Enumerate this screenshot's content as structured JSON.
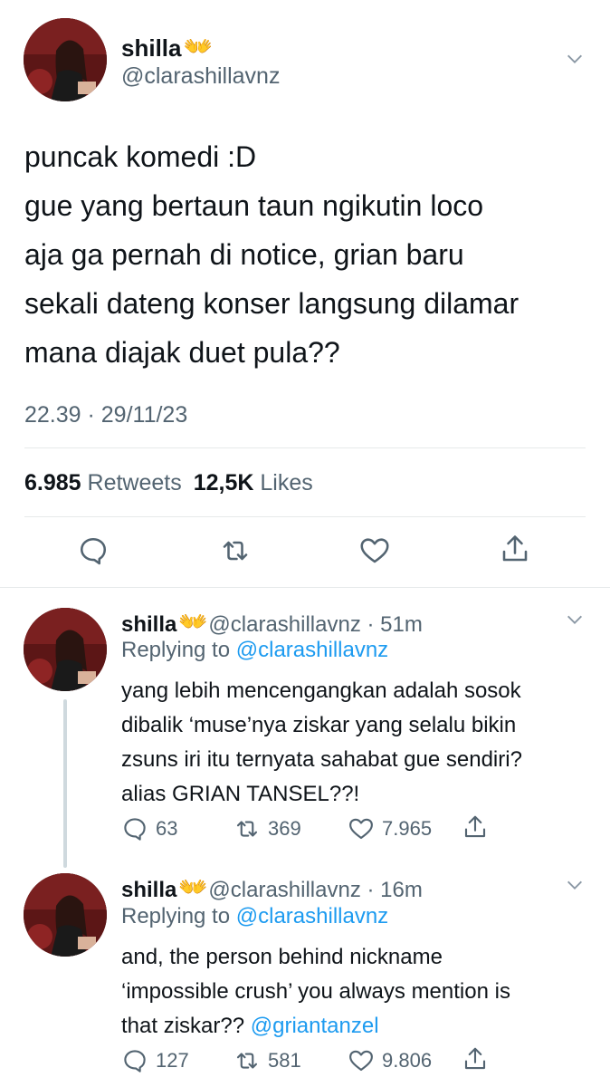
{
  "main_tweet": {
    "display_name": "shilla",
    "name_emoji": "🫶",
    "handle": "@clarashillavnz",
    "text_lines": [
      "puncak komedi :D",
      "gue yang bertaun taun ngikutin loco",
      "aja ga pernah di notice, grian baru",
      "sekali dateng konser langsung dilamar",
      "mana diajak duet pula??"
    ],
    "timestamp": "22.39 · 29/11/23",
    "retweets_count": "6.985",
    "retweets_label": "Retweets",
    "likes_count": "12,5K",
    "likes_label": "Likes"
  },
  "replies": [
    {
      "display_name": "shilla",
      "handle": "@clarashillavnz",
      "time": "· 51m",
      "replying_prefix": "Replying to",
      "replying_handle": "@clarashillavnz",
      "text_lines": [
        "yang lebih mencengangkan adalah sosok",
        "dibalik ‘muse’nya ziskar yang selalu bikin",
        "zsuns iri itu ternyata sahabat gue sendiri?",
        "alias GRIAN TANSEL??!"
      ],
      "replies_count": "63",
      "retweets_count": "369",
      "likes_count": "7.965"
    },
    {
      "display_name": "shilla",
      "handle": "@clarashillavnz",
      "time": "· 16m",
      "replying_prefix": "Replying to",
      "replying_handle": "@clarashillavnz",
      "text_lines": [
        "and, the person behind nickname",
        "‘impossible crush’ you always mention is",
        "that ziskar??"
      ],
      "mention": "@griantanzel",
      "replies_count": "127",
      "retweets_count": "581",
      "likes_count": "9.806"
    }
  ],
  "icons": {
    "reply": "speech-bubble-icon",
    "retweet": "retweet-arrows-icon",
    "like": "heart-outline-icon",
    "share": "share-upload-icon",
    "menu": "chevron-down-icon"
  },
  "colors": {
    "text": "#0f1419",
    "secondary": "#536471",
    "link": "#1d9bf0",
    "divider": "#e6e9ea"
  }
}
